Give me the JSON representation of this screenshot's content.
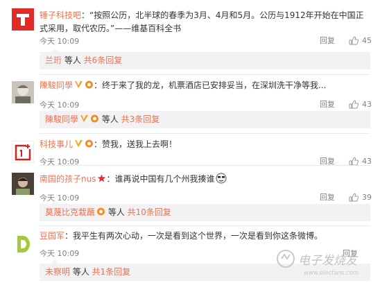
{
  "comments": [
    {
      "user": "锤子科技吧",
      "text": "：“按照公历，北半球的春季为3月、4月和5月。公历与1912年开始在中国正式采用，取代农历。”——维基百科全书",
      "time": "今天 10:09",
      "reply_label": "回复",
      "likes": "45",
      "sub": {
        "user": "兰珩",
        "mid": " 等人 ",
        "more": "共6条回复"
      }
    },
    {
      "user": "陳駿同學",
      "text": "：终于来了我的龙，机票酒店已安排妥当，在深圳洗干净等我...",
      "time": "今天 10:09",
      "reply_label": "回复",
      "likes": "43",
      "sub": {
        "user": "陳駿同學",
        "mid": " 等人 ",
        "more": "共3条回复"
      }
    },
    {
      "user": "科技事儿",
      "text": "：赞我，送我上去啊！",
      "time": "今天 10:09",
      "reply_label": "回复",
      "likes": "43"
    },
    {
      "user": "南国的孩子nus",
      "text": "：谁再说中国有几个州我揍谁",
      "time": "今天 10:09",
      "reply_label": "回复",
      "likes": "39",
      "sub": {
        "user": "莫蔑比克栽蘸",
        "mid": " 等人 ",
        "more": "共10条回复"
      }
    },
    {
      "user": "豆国军",
      "text": "：我平生有两次心动，一次是看到这个世界，一次是看到你这条微博。",
      "time": "今天 10:09",
      "reply_label": "回复",
      "likes": "",
      "sub": {
        "user": "未察明",
        "mid": " 等人 ",
        "more": "共1条回复"
      }
    }
  ],
  "watermark": {
    "line1": "电子发烧友",
    "line2": "www.elecfans.com"
  },
  "colors": {
    "username": "#eb7350",
    "text": "#333333",
    "meta": "#808080",
    "subbg": "#f2f2f5"
  }
}
